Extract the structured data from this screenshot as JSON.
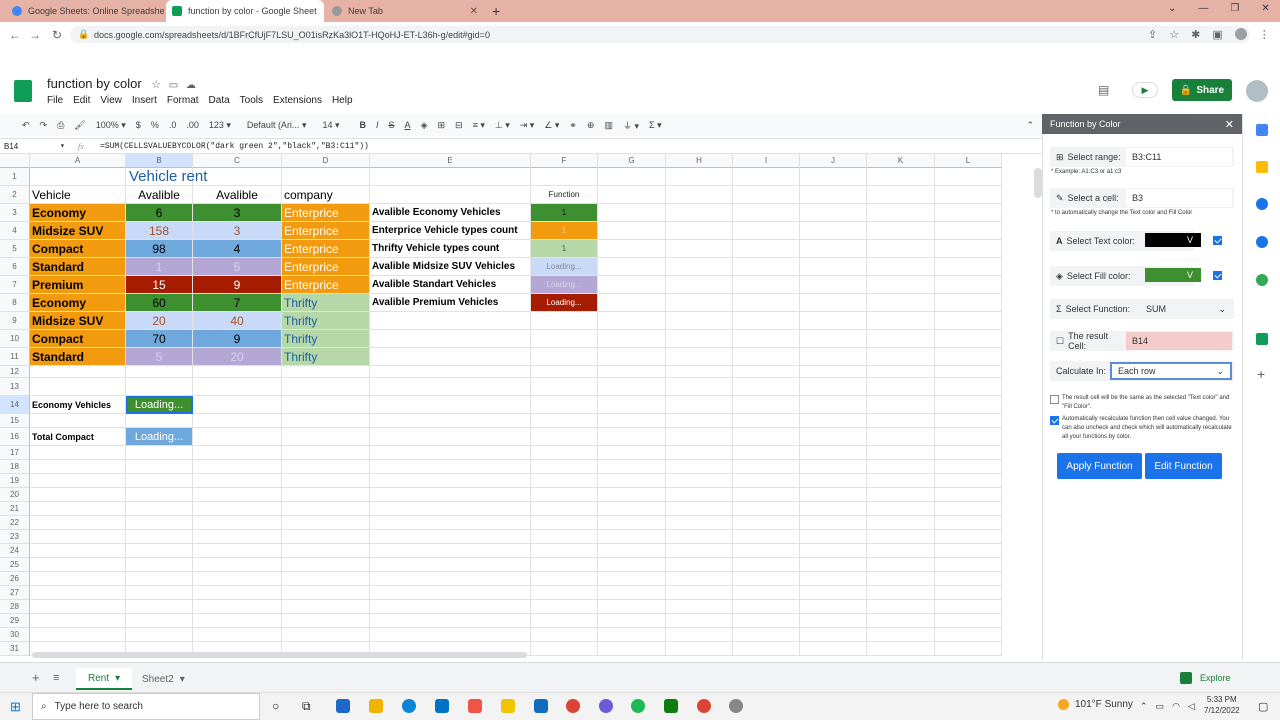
{
  "browser": {
    "tabs": [
      {
        "title": "Google Sheets: Online Spreadshe"
      },
      {
        "title": "function by color - Google Sheet"
      },
      {
        "title": "New Tab"
      }
    ],
    "url": "docs.google.com/spreadsheets/d/1BFrCfUjF7LSU_O01isRzKa3lO1T-HQoHJ-ET-L36h-g/edit#gid=0"
  },
  "doc": {
    "title": "function by color",
    "menu": [
      "File",
      "Edit",
      "View",
      "Insert",
      "Format",
      "Data",
      "Tools",
      "Extensions",
      "Help"
    ],
    "share_label": "Share",
    "zoom": "100%",
    "font": "Default (Ari...",
    "font_size": "14",
    "fmt_dollar": "$",
    "fmt_pct": "%",
    "fmt_dec0": ".0",
    "fmt_dec00": ".00",
    "fmt_123": "123",
    "bold": "B",
    "italic": "I",
    "strike": "S",
    "textcolor": "A",
    "sigma": "Σ"
  },
  "formula": {
    "cellref": "B14",
    "fx": "fx",
    "text": "=SUM(CELLSVALUEBYCOLOR(\"dark green 2\",\"black\",\"B3:C11\"))"
  },
  "grid": {
    "columns": [
      "A",
      "B",
      "C",
      "D",
      "E",
      "F",
      "G",
      "H",
      "I",
      "J",
      "K",
      "L"
    ],
    "rows": [
      "1",
      "2",
      "3",
      "4",
      "5",
      "6",
      "7",
      "8",
      "9",
      "10",
      "11",
      "12",
      "13",
      "14",
      "15",
      "16",
      "17",
      "18",
      "19",
      "20",
      "21",
      "22",
      "23",
      "24",
      "25",
      "26",
      "27",
      "28",
      "29",
      "30",
      "31"
    ],
    "b1": "Vehicle rent",
    "header": [
      "Vehicle",
      "Avalible",
      "Avalible",
      "company"
    ],
    "f2": "Function",
    "data": [
      [
        "Economy",
        "6",
        "3",
        "Enterprice"
      ],
      [
        "Midsize SUV",
        "158",
        "3",
        "Enterprice"
      ],
      [
        "Compact",
        "98",
        "4",
        "Enterprice"
      ],
      [
        "Standard",
        "1",
        "5",
        "Enterprice"
      ],
      [
        "Premium",
        "15",
        "9",
        "Enterprice"
      ],
      [
        "Economy",
        "60",
        "7",
        "Thrifty"
      ],
      [
        "Midsize SUV",
        "20",
        "40",
        "Thrifty"
      ],
      [
        "Compact",
        "70",
        "9",
        "Thrifty"
      ],
      [
        "Standard",
        "5",
        "20",
        "Thrifty"
      ]
    ],
    "e_labels": [
      "Avalible Economy Vehicles",
      "Enterprice Vehicle types count",
      "Thrifty Vehicle types count",
      "Avalible Midsize SUV Vehicles",
      "Avalible Standart Vehicles",
      "Avalible Premium Vehicles"
    ],
    "f_values": [
      "1",
      "1",
      "1",
      "Loading...",
      "Loading...",
      "Loading..."
    ],
    "a14": "Economy Vehicles",
    "b14": "Loading...",
    "a16": "Total Compact",
    "b16": "Loading..."
  },
  "sidebar": {
    "title": "Function by Color",
    "range_label": "Select range:",
    "range_value": "B3:C11",
    "range_hint": "* Example: A1:C3 or a1:c3",
    "cell_label": "Select a cell:",
    "cell_value": "B3",
    "cell_hint": "* to automatically change the Text color and Fill Color",
    "text_color_label": "Select Text color:",
    "fill_color_label": "Select Fill color:",
    "dropdown_v": "V",
    "function_label": "Select Function:",
    "function_value": "SUM",
    "result_label": "The result Cell:",
    "result_value": "B14",
    "calc_label": "Calculate In:",
    "calc_value": "Each row",
    "opt1": "The result cell will be the same as the selected \"Text color\" and \"Fill Color\".",
    "opt2": "Automatically recalculate function then cell value changed. You can also uncheck and check which will automatically recalculate all your functions by color.",
    "apply": "Apply Function",
    "edit": "Edit Function"
  },
  "sheets": {
    "tabs": [
      "Rent",
      "Sheet2"
    ],
    "explore": "Explore"
  },
  "taskbar": {
    "search": "Type here to search",
    "weather": "101°F Sunny",
    "time": "5:33 PM",
    "date": "7/12/2022"
  },
  "colors": {
    "orange": "#f29b0f",
    "green": "#3d8f2f",
    "blue": "#6fa8dc",
    "lightblue": "#c9daf8",
    "lavender": "#b4a7d6",
    "red": "#a61c00",
    "lightgreen": "#b6d7a8",
    "pink": "#f4cccc",
    "sheetsGreen": "#188038"
  }
}
